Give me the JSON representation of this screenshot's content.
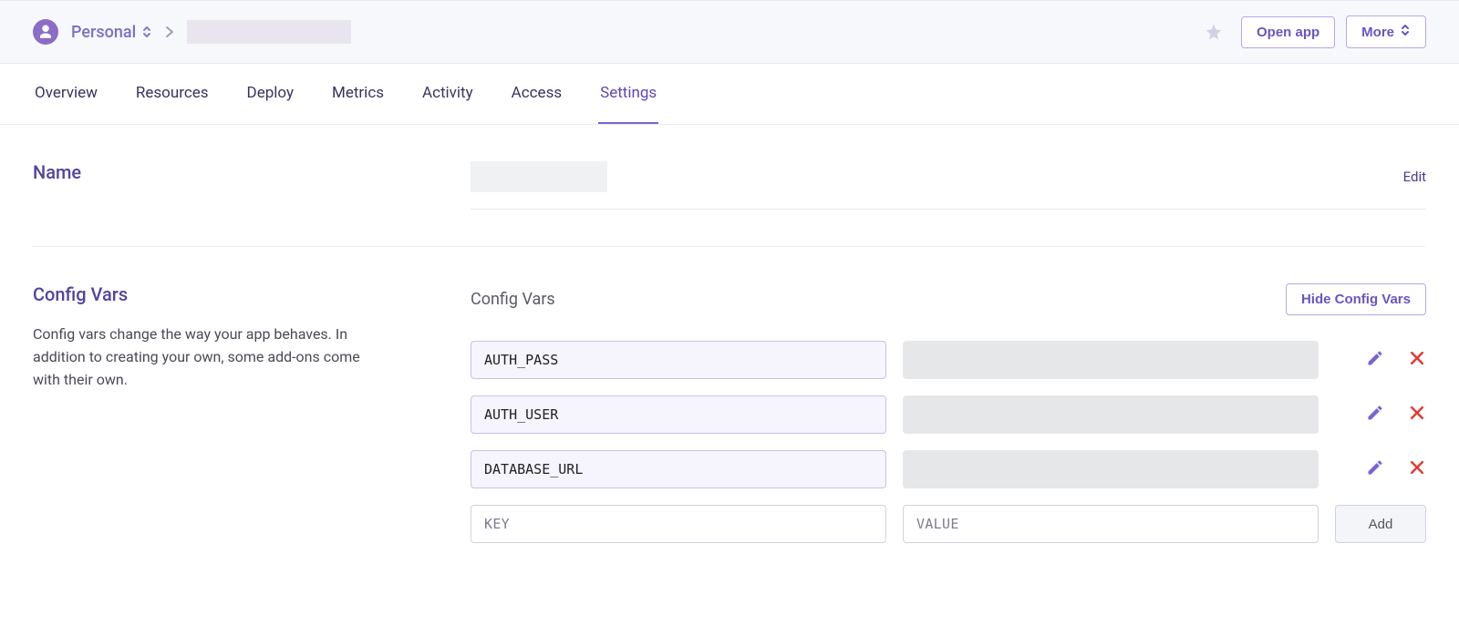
{
  "breadcrumb": {
    "team_label": "Personal"
  },
  "actions": {
    "open_app": "Open app",
    "more": "More"
  },
  "tabs": [
    {
      "label": "Overview",
      "active": false
    },
    {
      "label": "Resources",
      "active": false
    },
    {
      "label": "Deploy",
      "active": false
    },
    {
      "label": "Metrics",
      "active": false
    },
    {
      "label": "Activity",
      "active": false
    },
    {
      "label": "Access",
      "active": false
    },
    {
      "label": "Settings",
      "active": true
    }
  ],
  "name_section": {
    "title": "Name",
    "edit_label": "Edit"
  },
  "config_vars_section": {
    "title": "Config Vars",
    "description": "Config vars change the way your app behaves. In addition to creating your own, some add-ons come with their own.",
    "panel_title": "Config Vars",
    "hide_button": "Hide Config Vars",
    "vars": [
      {
        "key": "AUTH_PASS"
      },
      {
        "key": "AUTH_USER"
      },
      {
        "key": "DATABASE_URL"
      }
    ],
    "new_row": {
      "key_placeholder": "KEY",
      "value_placeholder": "VALUE",
      "add_label": "Add"
    }
  }
}
